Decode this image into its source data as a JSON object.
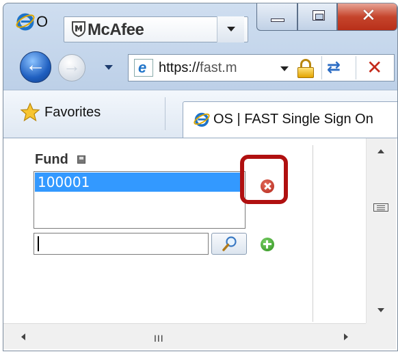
{
  "window": {
    "title": "OS | FAST Single Sign On",
    "title_visible": "O",
    "caption_buttons": [
      "minimize",
      "maximize",
      "close"
    ]
  },
  "mcafee": {
    "brand": "McAfee"
  },
  "navigation": {
    "address_url_scheme": "https://",
    "address_url_rest": "fast.m",
    "icons": [
      "back-icon",
      "forward-icon",
      "ie-page-icon",
      "lock-icon",
      "compatibility-icon",
      "stop-icon"
    ]
  },
  "favorites_bar": {
    "favorites_label": "Favorites",
    "tab_label": "OS | FAST Single Sign On"
  },
  "form": {
    "fund_label": "Fund",
    "fund_list_items": [
      "100001"
    ],
    "selected_item": "100001",
    "search_value": "",
    "icons": [
      "save-icon",
      "remove-icon",
      "magnifier-icon",
      "add-icon"
    ]
  },
  "scrollbars": {
    "h_grip": "III"
  },
  "colors": {
    "selection": "#3399ff",
    "highlight_border": "#b01010",
    "remove_button": "#c0392b",
    "add_button": "#3a9d23",
    "close_button": "#c5442c"
  }
}
